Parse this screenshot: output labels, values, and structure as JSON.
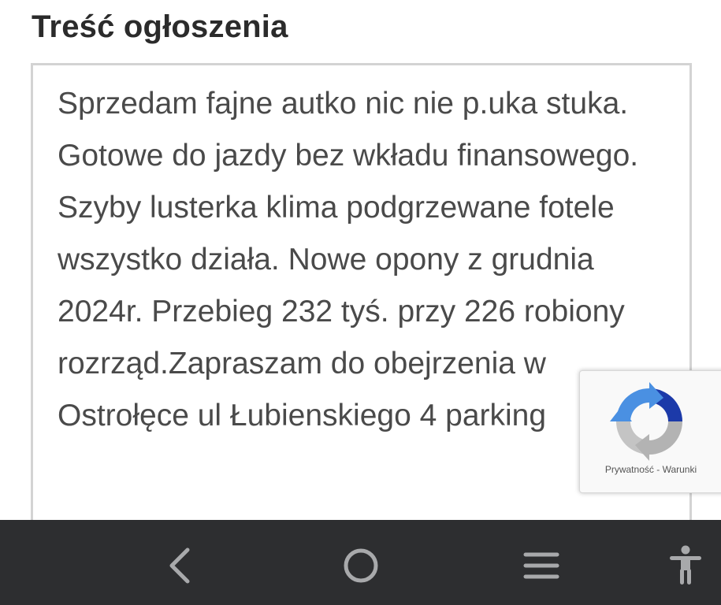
{
  "form": {
    "section_title": "Treść ogłoszenia",
    "description_value": "Sprzedam fajne autko nic nie p.uka stuka. Gotowe do jazdy bez wkładu finansowego. Szyby lusterka klima podgrzewane fotele wszystko działa. Nowe opony z grudnia 2024r. Przebieg 232 tyś. przy 226 robiony rozrząd.Zapraszam do obejrzenia w Ostrołęce ul Łubienskiego 4 parking"
  },
  "recaptcha": {
    "icon": "recaptcha-logo-icon",
    "privacy_label": "Prywatność",
    "separator": "-",
    "terms_label": "Warunki",
    "colors": {
      "blue": "#1c3aa9",
      "light_blue": "#4a90e2",
      "gray": "#b3b3b3"
    }
  },
  "system_nav": {
    "back_icon": "back-chevron-icon",
    "home_icon": "home-circle-icon",
    "recents_icon": "recents-menu-icon",
    "accessibility_icon": "accessibility-person-icon",
    "bar_color": "#2d2e30",
    "icon_color": "#a8a9ab"
  }
}
